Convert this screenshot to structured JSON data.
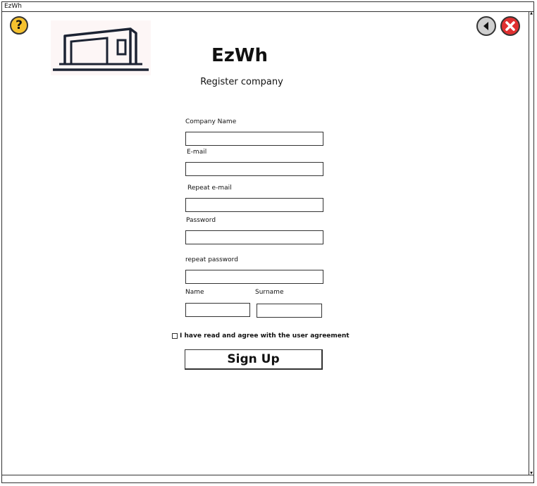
{
  "window": {
    "title": "EzWh"
  },
  "header": {
    "help_label": "?",
    "app_name": "EzWh",
    "subtitle": "Register company"
  },
  "form": {
    "company_name_label": "Company Name",
    "email_label": "E-mail",
    "repeat_email_label": "Repeat e-mail",
    "password_label": "Password",
    "repeat_password_label": "repeat password",
    "name_label": "Name",
    "surname_label": "Surname",
    "agreement_text": "I have read and agree with the user agreement",
    "signup_label": "Sign Up"
  },
  "icons": {
    "help": "question-mark-icon",
    "back": "back-arrow-icon",
    "close": "close-icon",
    "logo": "warehouse-logo"
  },
  "colors": {
    "help": "#f5c12e",
    "back": "#cfcfcf",
    "close": "#e03030"
  }
}
